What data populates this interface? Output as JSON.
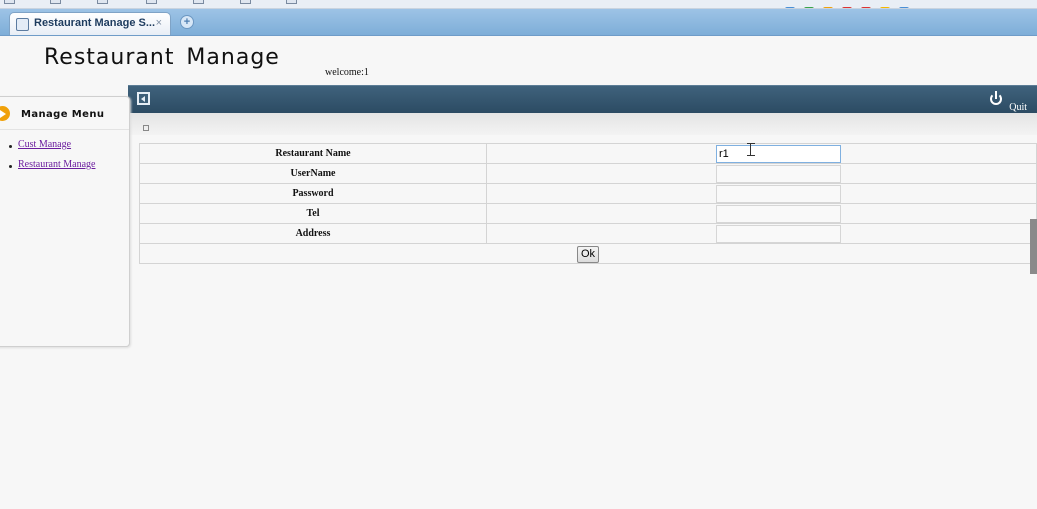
{
  "browser": {
    "tab_title": "Restaurant Manage S...",
    "tab_close": "×",
    "new_tab": "+"
  },
  "header": {
    "title": "Restaurant Manage",
    "welcome": "welcome:1"
  },
  "topbar": {
    "quit_label": "Quit"
  },
  "menu": {
    "title": "Manage Menu",
    "items": [
      {
        "label": "Cust Manage"
      },
      {
        "label": "Restaurant Manage"
      }
    ]
  },
  "form": {
    "fields": [
      {
        "label": "Restaurant Name",
        "value": "r1"
      },
      {
        "label": "UserName",
        "value": ""
      },
      {
        "label": "Password",
        "value": ""
      },
      {
        "label": "Tel",
        "value": ""
      },
      {
        "label": "Address",
        "value": ""
      }
    ],
    "submit_label": "Ok"
  },
  "colors": {
    "topbar": "#2f4f67",
    "accent_arrow": "#f0a10a",
    "link_visited": "#6b1d9e",
    "tabstrip": "#8cb8e0"
  }
}
